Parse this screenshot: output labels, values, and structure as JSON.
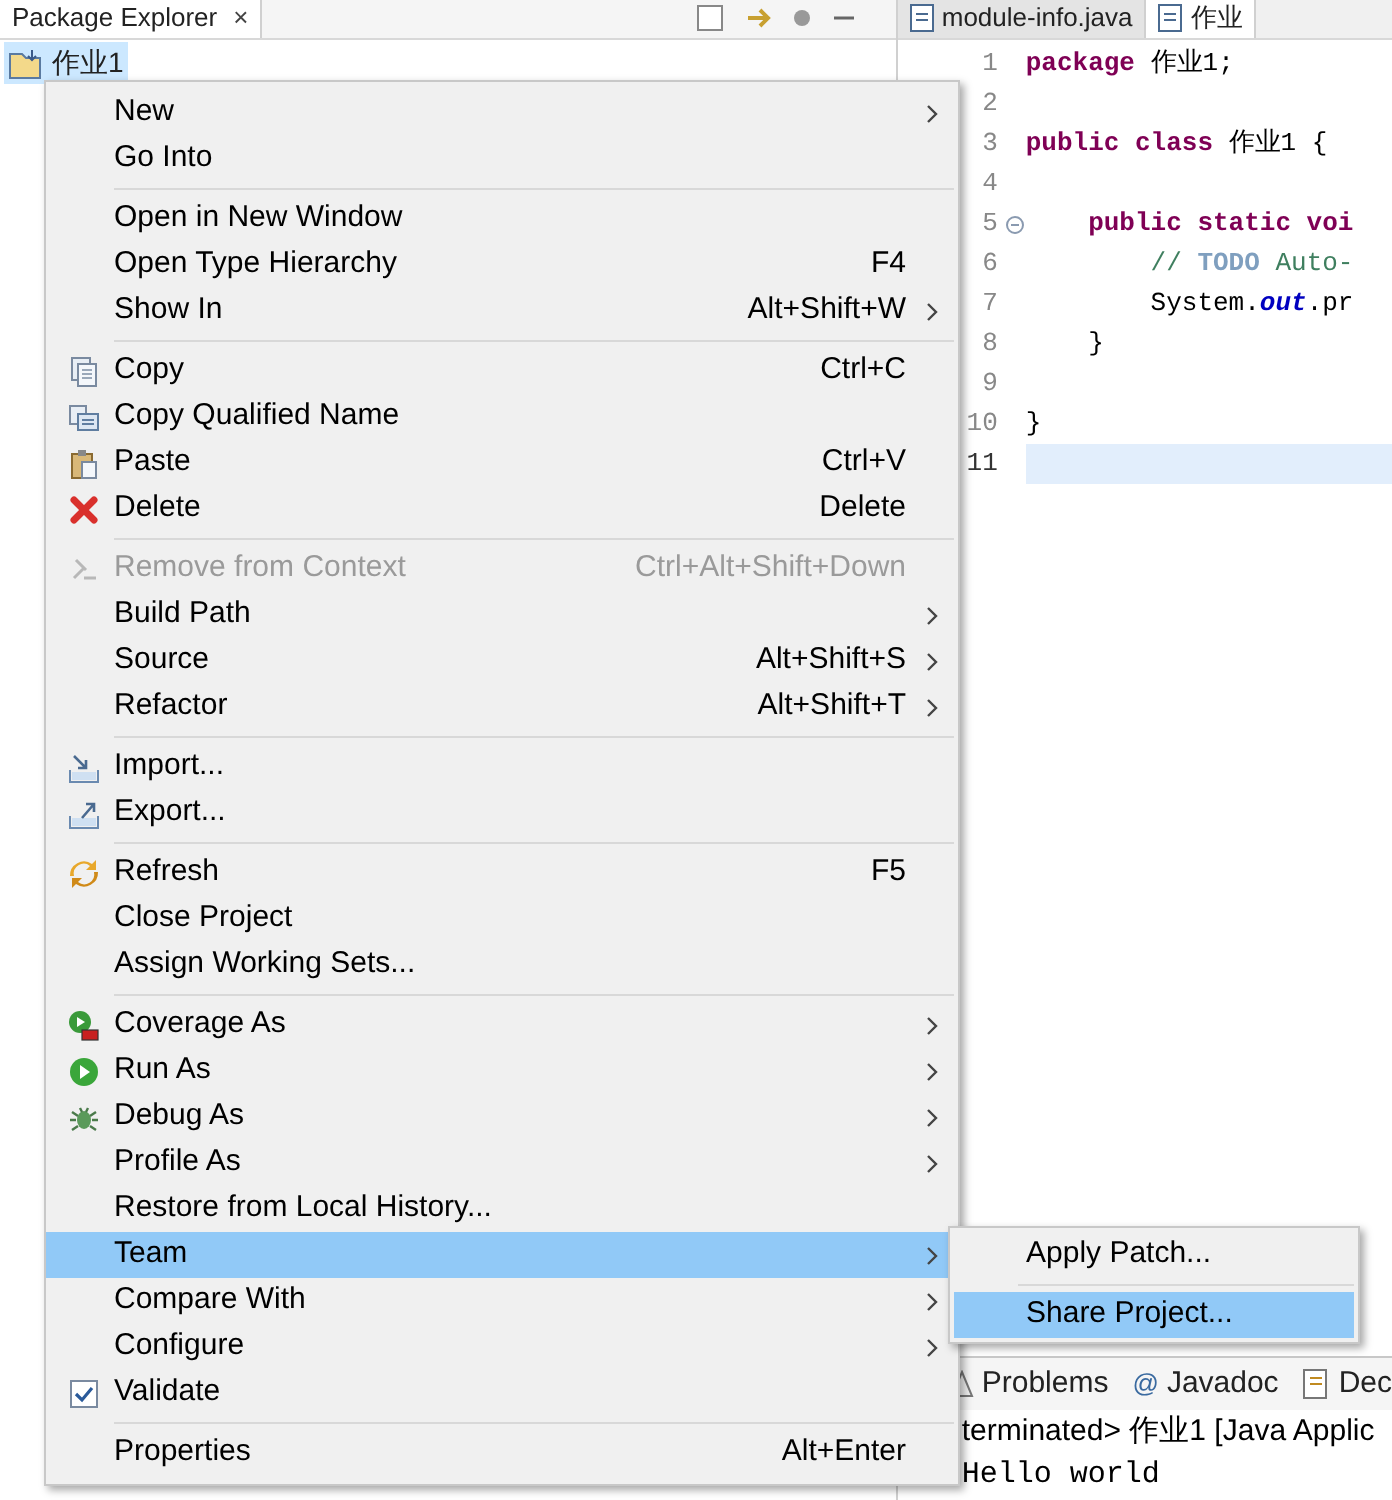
{
  "package_explorer": {
    "tab": {
      "title": "Package Explorer",
      "close": "×"
    },
    "tree": [
      {
        "label": "作业1",
        "selected": true
      }
    ]
  },
  "editor": {
    "tabs": [
      {
        "title": "module-info.java",
        "selected": false
      },
      {
        "title": "作业",
        "selected": true
      }
    ],
    "lines": [
      {
        "number": "1",
        "current": false,
        "tokens": [
          {
            "kind": "keyword",
            "text": "package"
          },
          {
            "kind": "plain",
            "text": " 作业1;"
          }
        ]
      },
      {
        "number": "2",
        "current": false
      },
      {
        "number": "3",
        "current": false,
        "tokens": [
          {
            "kind": "keyword",
            "text": "public class"
          },
          {
            "kind": "plain",
            "text": " 作业1 {"
          }
        ]
      },
      {
        "number": "4",
        "current": false
      },
      {
        "number": "5",
        "current": false,
        "fold": true,
        "tokens": [
          {
            "kind": "keyword",
            "text": "    public static voi"
          }
        ]
      },
      {
        "number": "6",
        "current": false,
        "tokens": [
          {
            "kind": "comment",
            "text": "        // "
          },
          {
            "kind": "todo",
            "text": "TODO"
          },
          {
            "kind": "comment",
            "text": " Auto-"
          }
        ]
      },
      {
        "number": "7",
        "current": false,
        "tokens": [
          {
            "kind": "plain",
            "text": "        System."
          },
          {
            "kind": "field",
            "text": "out"
          },
          {
            "kind": "plain",
            "text": ".pr"
          }
        ]
      },
      {
        "number": "8",
        "current": false,
        "tokens": [
          {
            "kind": "plain",
            "text": "    }"
          }
        ]
      },
      {
        "number": "9",
        "current": false
      },
      {
        "number": "10",
        "current": false,
        "tokens": [
          {
            "kind": "plain",
            "text": "}"
          }
        ]
      },
      {
        "number": "11",
        "current": true
      }
    ]
  },
  "bottom_panel": {
    "tabs": [
      {
        "title": "Problems"
      },
      {
        "glyph": "@",
        "title": "Javadoc"
      },
      {
        "title": "Dec"
      }
    ],
    "console": [
      "terminated> 作业1 [Java Applic",
      "Hello world"
    ]
  },
  "context_menu": {
    "groups": [
      [
        {
          "kind": "command",
          "label": "New",
          "submenu": true,
          "disabled": false,
          "selected": false
        },
        {
          "kind": "command",
          "label": "Go Into",
          "submenu": false,
          "disabled": false,
          "selected": false
        }
      ],
      [
        {
          "kind": "command",
          "label": "Open in New Window",
          "submenu": false,
          "disabled": false,
          "selected": false
        },
        {
          "kind": "command",
          "label": "Open Type Hierarchy",
          "shortcut": "F4",
          "submenu": false,
          "disabled": false,
          "selected": false
        },
        {
          "kind": "command",
          "label": "Show In",
          "shortcut": "Alt+Shift+W",
          "submenu": true,
          "disabled": false,
          "selected": false
        }
      ],
      [
        {
          "kind": "command",
          "label": "Copy",
          "shortcut": "Ctrl+C",
          "submenu": false,
          "disabled": false,
          "selected": false
        },
        {
          "kind": "command",
          "label": "Copy Qualified Name",
          "submenu": false,
          "disabled": false,
          "selected": false
        },
        {
          "kind": "command",
          "label": "Paste",
          "shortcut": "Ctrl+V",
          "submenu": false,
          "disabled": false,
          "selected": false
        },
        {
          "kind": "command",
          "label": "Delete",
          "shortcut": "Delete",
          "submenu": false,
          "disabled": false,
          "selected": false
        }
      ],
      [
        {
          "kind": "command",
          "label": "Remove from Context",
          "shortcut": "Ctrl+Alt+Shift+Down",
          "submenu": false,
          "disabled": true,
          "selected": false
        },
        {
          "kind": "command",
          "label": "Build Path",
          "submenu": true,
          "disabled": false,
          "selected": false
        },
        {
          "kind": "command",
          "label": "Source",
          "shortcut": "Alt+Shift+S",
          "submenu": true,
          "disabled": false,
          "selected": false
        },
        {
          "kind": "command",
          "label": "Refactor",
          "shortcut": "Alt+Shift+T",
          "submenu": true,
          "disabled": false,
          "selected": false
        }
      ],
      [
        {
          "kind": "command",
          "label": "Import...",
          "submenu": false,
          "disabled": false,
          "selected": false
        },
        {
          "kind": "command",
          "label": "Export...",
          "submenu": false,
          "disabled": false,
          "selected": false
        }
      ],
      [
        {
          "kind": "command",
          "label": "Refresh",
          "shortcut": "F5",
          "submenu": false,
          "disabled": false,
          "selected": false
        },
        {
          "kind": "command",
          "label": "Close Project",
          "submenu": false,
          "disabled": false,
          "selected": false
        },
        {
          "kind": "command",
          "label": "Assign Working Sets...",
          "submenu": false,
          "disabled": false,
          "selected": false
        }
      ],
      [
        {
          "kind": "command",
          "label": "Coverage As",
          "submenu": true,
          "disabled": false,
          "selected": false
        },
        {
          "kind": "command",
          "label": "Run As",
          "submenu": true,
          "disabled": false,
          "selected": false
        },
        {
          "kind": "command",
          "label": "Debug As",
          "submenu": true,
          "disabled": false,
          "selected": false
        },
        {
          "kind": "command",
          "label": "Profile As",
          "submenu": true,
          "disabled": false,
          "selected": false
        },
        {
          "kind": "command",
          "label": "Restore from Local History...",
          "submenu": false,
          "disabled": false,
          "selected": false
        },
        {
          "kind": "command",
          "label": "Team",
          "submenu": true,
          "disabled": false,
          "selected": true
        },
        {
          "kind": "command",
          "label": "Compare With",
          "submenu": true,
          "disabled": false,
          "selected": false
        },
        {
          "kind": "command",
          "label": "Configure",
          "submenu": true,
          "disabled": false,
          "selected": false
        },
        {
          "kind": "check",
          "label": "Validate",
          "checked": true,
          "submenu": false,
          "disabled": false,
          "selected": false
        }
      ],
      [
        {
          "kind": "command",
          "label": "Properties",
          "shortcut": "Alt+Enter",
          "submenu": false,
          "disabled": false,
          "selected": false
        }
      ]
    ]
  },
  "submenu": {
    "groups": [
      [
        {
          "label": "Apply Patch...",
          "selected": false
        }
      ],
      [
        {
          "label": "Share Project...",
          "selected": true
        }
      ]
    ]
  }
}
